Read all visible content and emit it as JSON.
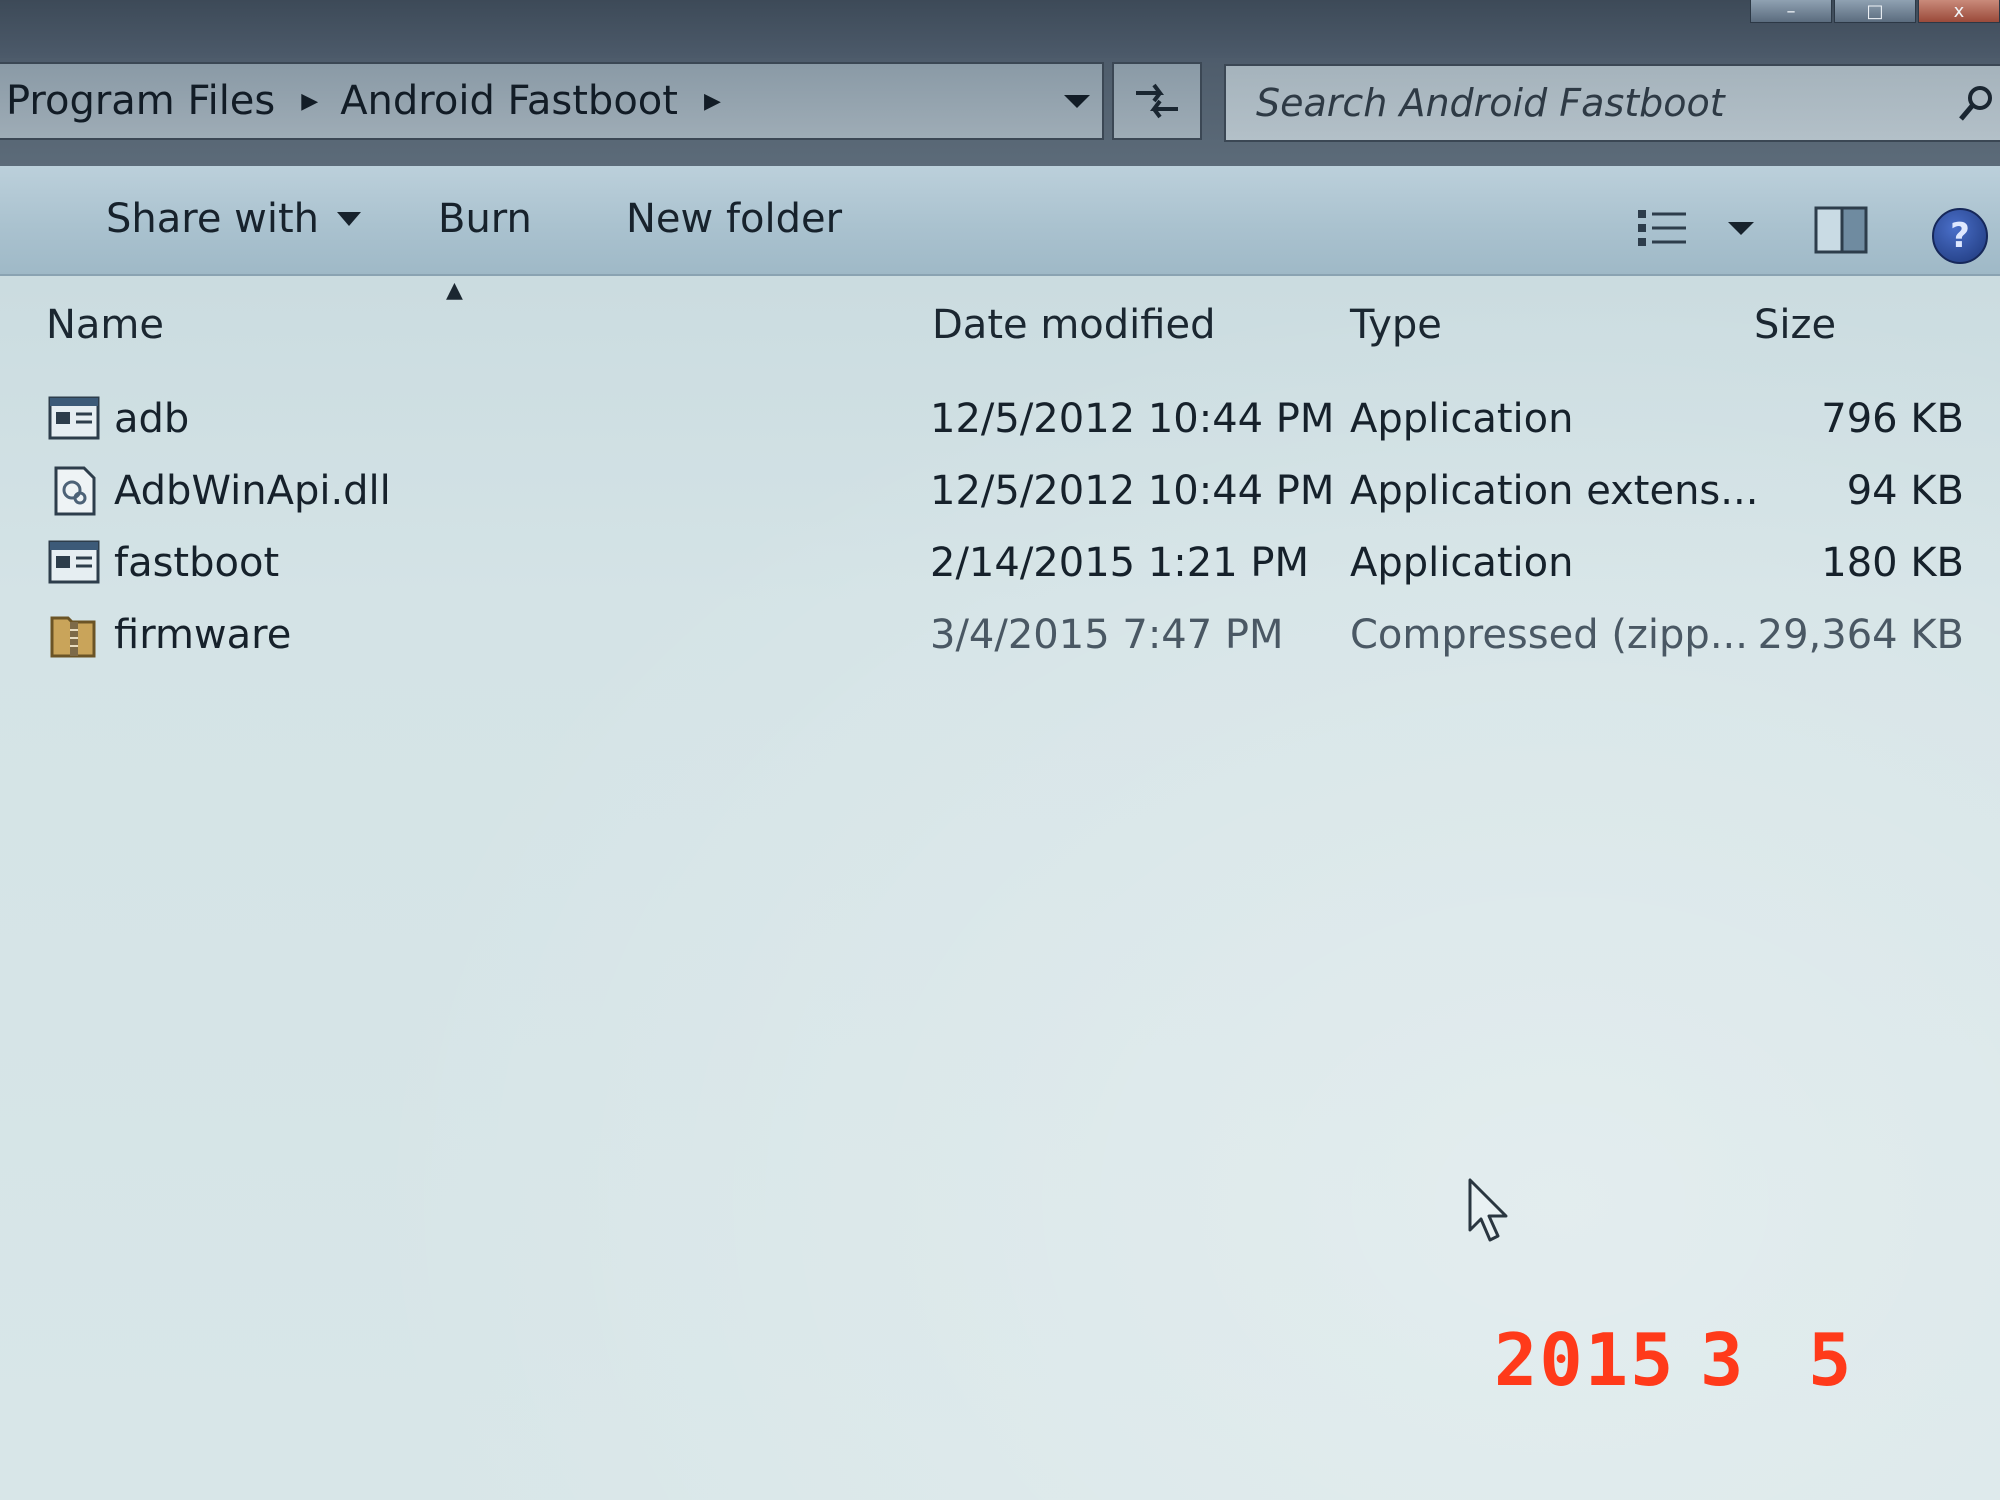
{
  "window": {
    "controls": [
      "–",
      "□",
      "x"
    ]
  },
  "address_bar": {
    "breadcrumbs": [
      "Program Files",
      "Android Fastboot"
    ]
  },
  "search": {
    "placeholder": "Search Android Fastboot"
  },
  "toolbar": {
    "share_with_label": "Share with",
    "burn_label": "Burn",
    "new_folder_label": "New folder",
    "help_label": "?"
  },
  "columns": {
    "name": "Name",
    "date_modified": "Date modified",
    "type": "Type",
    "size": "Size"
  },
  "files": [
    {
      "name": "adb",
      "date_modified": "12/5/2012 10:44 PM",
      "type": "Application",
      "size": "796 KB",
      "icon": "application-icon"
    },
    {
      "name": "AdbWinApi.dll",
      "date_modified": "12/5/2012 10:44 PM",
      "type": "Application extens...",
      "size": "94 KB",
      "icon": "dll-icon"
    },
    {
      "name": "fastboot",
      "date_modified": "2/14/2015 1:21 PM",
      "type": "Application",
      "size": "180 KB",
      "icon": "application-icon"
    },
    {
      "name": "firmware",
      "date_modified": "3/4/2015 7:47 PM",
      "type": "Compressed (zipp...",
      "size": "29,364 KB",
      "icon": "zip-folder-icon"
    }
  ],
  "camera_date_stamp": {
    "year": "2015",
    "month": "3",
    "day": "5"
  },
  "colors": {
    "date_stamp": "#ff3a1a",
    "toolbar": "#aac2cf",
    "content_background": "#d4e3e6"
  }
}
